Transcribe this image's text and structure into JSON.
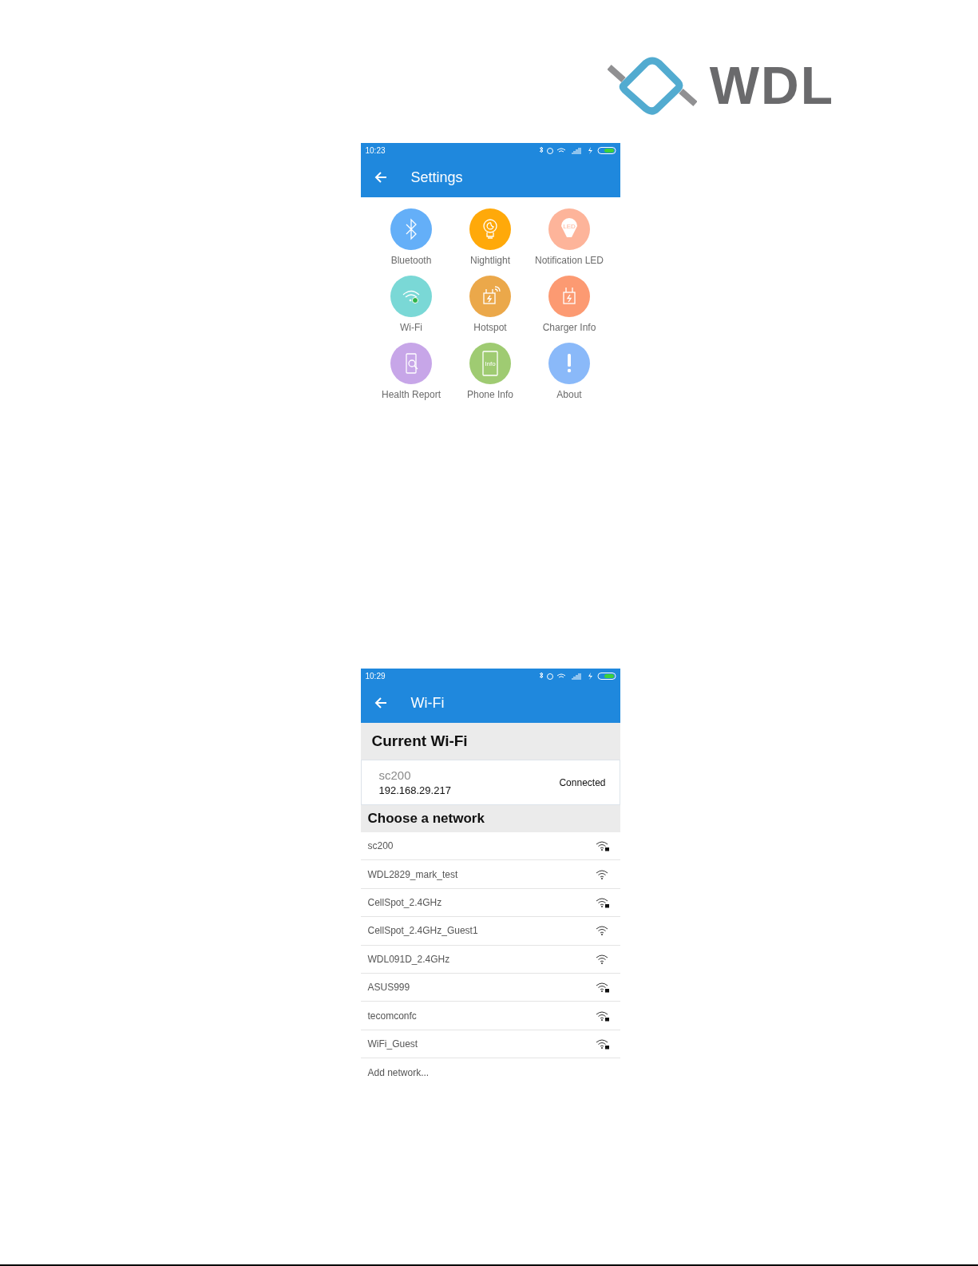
{
  "logo": {
    "text": "WDL"
  },
  "settings_screen": {
    "status_bar": {
      "time": "10:23"
    },
    "title": "Settings",
    "items": [
      {
        "label": "Bluetooth",
        "kind": "bluetooth",
        "color": "#64aff8"
      },
      {
        "label": "Nightlight",
        "kind": "bulb",
        "color": "#ffa90a"
      },
      {
        "label": "Notification LED",
        "kind": "led",
        "icon_text": "LED",
        "color": "#fdb49a"
      },
      {
        "label": "Wi-Fi",
        "kind": "wifi",
        "color": "#7ad8d6"
      },
      {
        "label": "Hotspot",
        "kind": "hotspot",
        "color": "#eba84a"
      },
      {
        "label": "Charger Info",
        "kind": "charger",
        "color": "#fc9a72"
      },
      {
        "label": "Health Report",
        "kind": "health",
        "color": "#c7a6e8"
      },
      {
        "label": "Phone Info",
        "kind": "phone",
        "icon_text": "Info",
        "color": "#9fcb72"
      },
      {
        "label": "About",
        "kind": "about",
        "color": "#8ab9f9"
      }
    ]
  },
  "wifi_screen": {
    "status_bar": {
      "time": "10:29"
    },
    "title": "Wi-Fi",
    "current_heading": "Current Wi-Fi",
    "current": {
      "ssid": "sc200",
      "ip": "192.168.29.217",
      "status": "Connected"
    },
    "choose_heading": "Choose a network",
    "networks": [
      {
        "ssid": "sc200",
        "locked": true
      },
      {
        "ssid": "WDL2829_mark_test",
        "locked": false
      },
      {
        "ssid": "CellSpot_2.4GHz",
        "locked": true
      },
      {
        "ssid": "CellSpot_2.4GHz_Guest1",
        "locked": false
      },
      {
        "ssid": "WDL091D_2.4GHz",
        "locked": false
      },
      {
        "ssid": "ASUS999",
        "locked": true
      },
      {
        "ssid": "tecomconfc",
        "locked": true
      },
      {
        "ssid": "WiFi_Guest",
        "locked": true
      }
    ],
    "add_network": "Add network..."
  }
}
